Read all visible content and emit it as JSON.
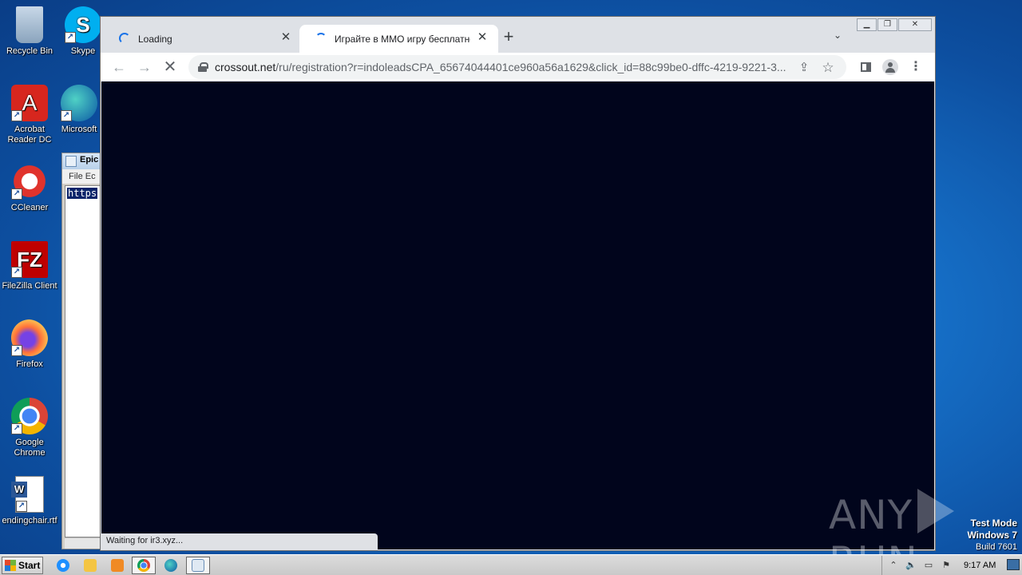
{
  "desktop": {
    "icons": [
      {
        "label": "Recycle Bin",
        "icon": "recycle-bin-icon"
      },
      {
        "label": "Skype",
        "icon": "skype-icon"
      },
      {
        "label": "Acrobat Reader DC",
        "icon": "acrobat-icon"
      },
      {
        "label": "Microsoft",
        "icon": "edge-icon"
      },
      {
        "label": "CCleaner",
        "icon": "ccleaner-icon"
      },
      {
        "label": "FileZilla Client",
        "icon": "filezilla-icon"
      },
      {
        "label": "Firefox",
        "icon": "firefox-icon"
      },
      {
        "label": "Google Chrome",
        "icon": "chrome-icon"
      },
      {
        "label": "endingchair.rtf",
        "icon": "word-doc-icon"
      }
    ],
    "watermark": {
      "left": "ANY",
      "right": "RUN"
    },
    "test_mode": {
      "line1": "Test Mode",
      "line2": "Windows 7",
      "line3": "Build 7601"
    }
  },
  "notepad": {
    "title": "Epic",
    "menu": "File  Ec",
    "selected_text": "https"
  },
  "browser": {
    "tabs": [
      {
        "title": "Loading"
      },
      {
        "title": "Играйте в ММО игру бесплатно —"
      }
    ],
    "url_host": "crossout.net",
    "url_rest": "/ru/registration?r=indoleadsCPA_65674044401ce960a56a1629&click_id=88c99be0-dffc-4219-9221-3...",
    "status": "Waiting for ir3.xyz..."
  },
  "taskbar": {
    "start_label": "Start",
    "clock": "9:17 AM"
  },
  "colors": {
    "page_bg": "#01051c",
    "accent": "#1a73e8"
  }
}
